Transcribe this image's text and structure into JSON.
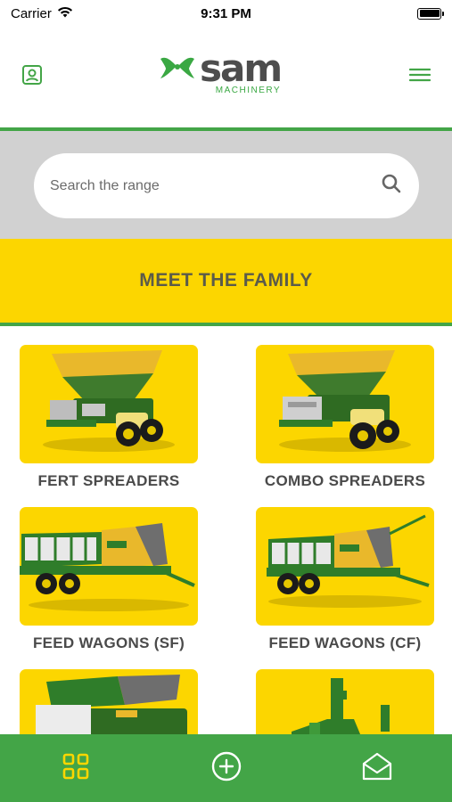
{
  "status_bar": {
    "carrier": "Carrier",
    "time": "9:31 PM"
  },
  "header": {
    "logo_text": "sam",
    "logo_subtext": "MACHINERY"
  },
  "search": {
    "placeholder": "Search the range"
  },
  "section_title": "MEET THE FAMILY",
  "products": [
    {
      "label": "FERT SPREADERS"
    },
    {
      "label": "COMBO SPREADERS"
    },
    {
      "label": "FEED WAGONS (SF)"
    },
    {
      "label": "FEED WAGONS (CF)"
    },
    {
      "label": ""
    },
    {
      "label": ""
    }
  ],
  "tab_bar": {
    "items": [
      "grid-icon",
      "plus-circle-icon",
      "mail-icon"
    ]
  },
  "colors": {
    "brand_green": "#43a547",
    "brand_yellow": "#fcd600",
    "logo_grey": "#4d4d4d",
    "search_band": "#d1d1d1"
  }
}
